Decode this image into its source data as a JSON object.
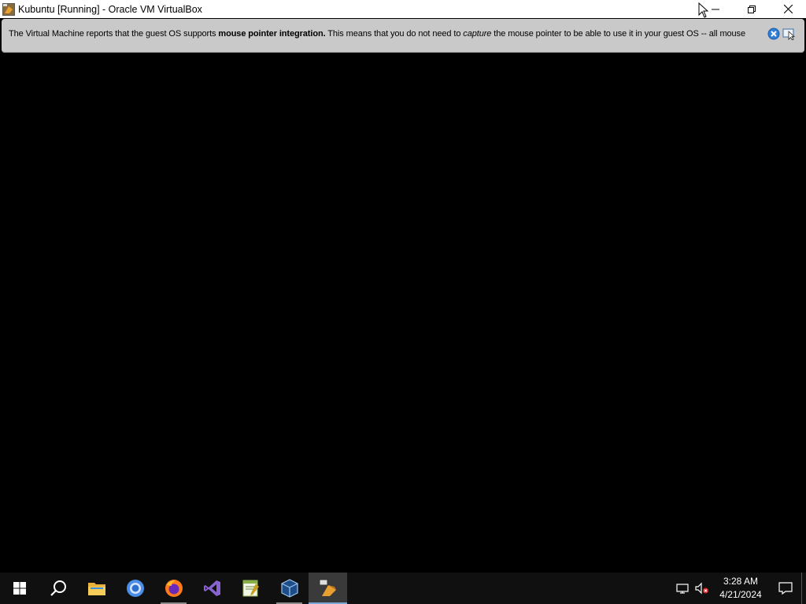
{
  "window": {
    "title": "Kubuntu [Running] - Oracle VM VirtualBox",
    "controls": [
      "minimize",
      "restore",
      "close"
    ]
  },
  "notification": {
    "text_before": "The Virtual Machine reports that the guest OS supports ",
    "bold": "mouse pointer integration.",
    "text_mid": " This means that you do not need to ",
    "italic": "capture",
    "text_after": " the mouse pointer to be able to use it in your guest OS -- all mouse",
    "icons": [
      "close-notification-icon",
      "mouse-integration-icon"
    ]
  },
  "taskbar": {
    "items": [
      {
        "name": "start",
        "icon": "windows-logo-icon"
      },
      {
        "name": "search",
        "icon": "search-icon"
      },
      {
        "name": "file-explorer",
        "icon": "folder-icon"
      },
      {
        "name": "chrome",
        "icon": "chrome-icon"
      },
      {
        "name": "firefox",
        "icon": "firefox-icon"
      },
      {
        "name": "visual-studio",
        "icon": "visual-studio-icon"
      },
      {
        "name": "notepad-plus-plus",
        "icon": "notepad-plus-plus-icon"
      },
      {
        "name": "virtualbox",
        "icon": "virtualbox-icon"
      },
      {
        "name": "kubuntu-vm",
        "icon": "vm-window-icon"
      }
    ],
    "clock": {
      "time": "3:28 AM",
      "date": "4/21/2024"
    },
    "tray": [
      "network-icon",
      "volume-muted-icon"
    ]
  }
}
